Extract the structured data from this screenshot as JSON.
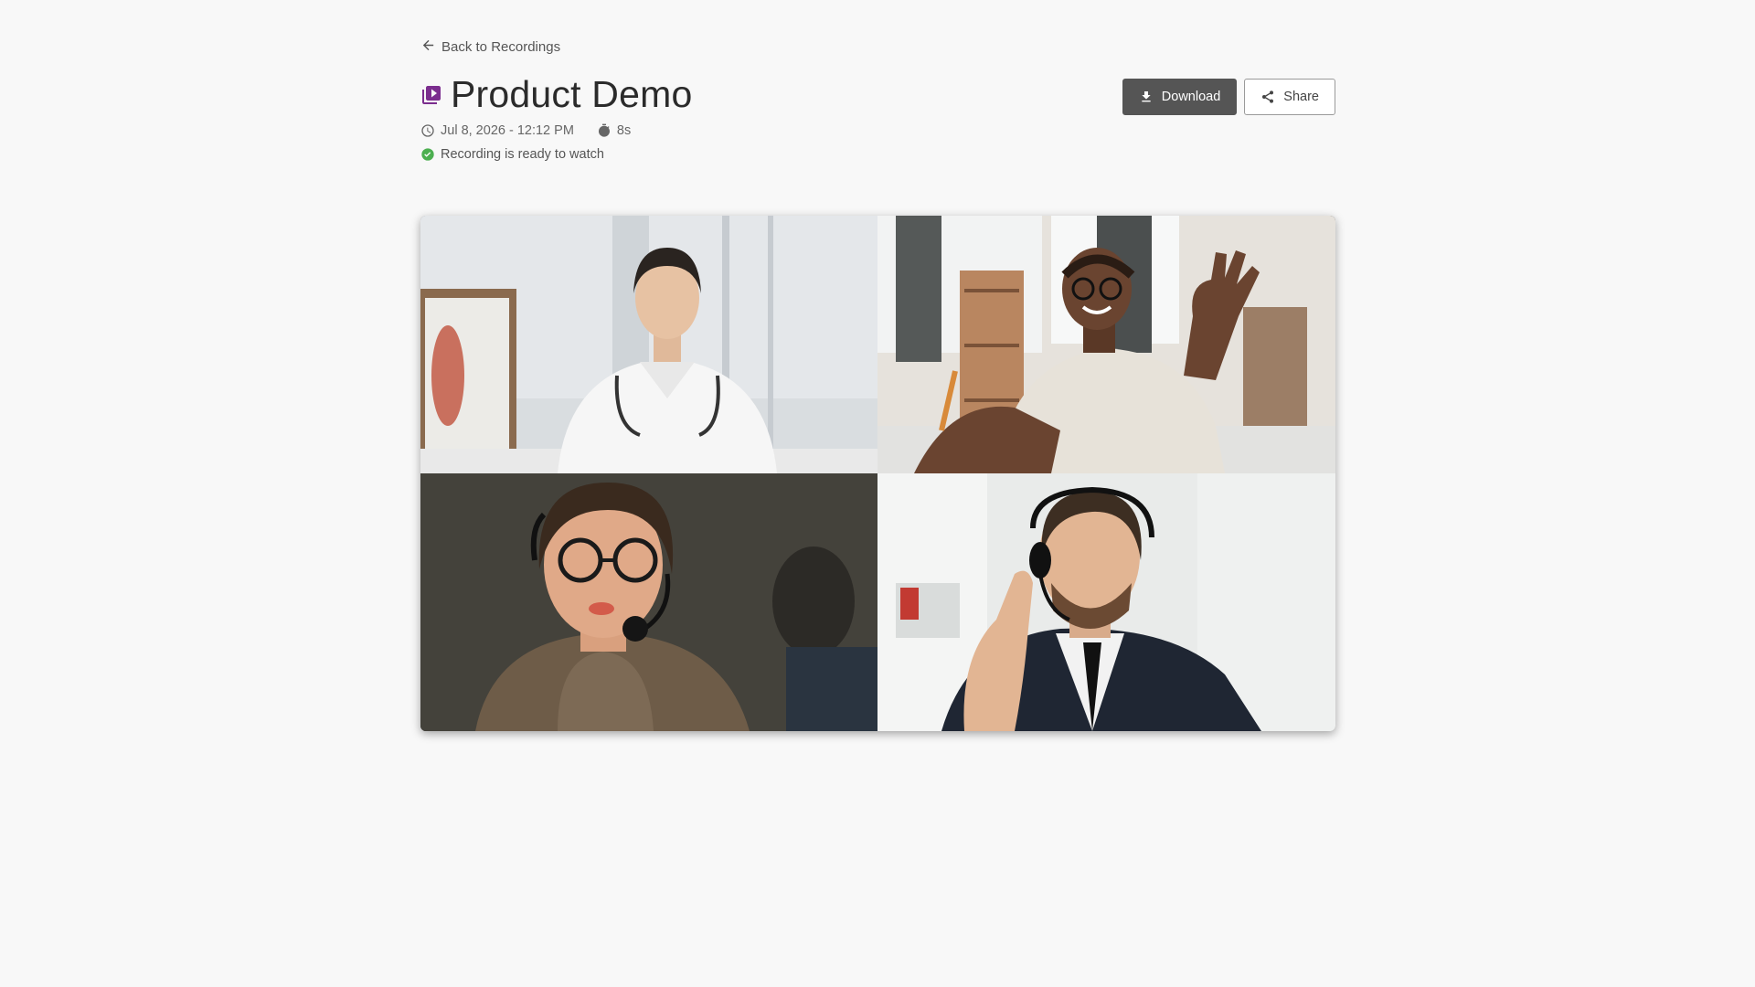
{
  "nav": {
    "back_label": "Back to Recordings"
  },
  "recording": {
    "title": "Product Demo",
    "date": "Jul 8, 2026 - 12:12 PM",
    "duration": "8s",
    "status": "Recording is ready to watch"
  },
  "actions": {
    "download_label": "Download",
    "share_label": "Share"
  },
  "icons": {
    "back": "arrow-left-icon",
    "recording": "video-library-icon",
    "date": "clock-icon",
    "duration": "timer-icon",
    "status": "check-circle-icon",
    "download": "download-icon",
    "share": "share-icon"
  },
  "colors": {
    "accent": "#7b2d8e",
    "success": "#4caf50",
    "download_bg": "#555555",
    "background": "#f8f8f8"
  },
  "participants": [
    {
      "role": "doctor-in-white-coat"
    },
    {
      "role": "man-waving"
    },
    {
      "role": "woman-with-headset"
    },
    {
      "role": "man-in-suit-with-headset"
    }
  ]
}
